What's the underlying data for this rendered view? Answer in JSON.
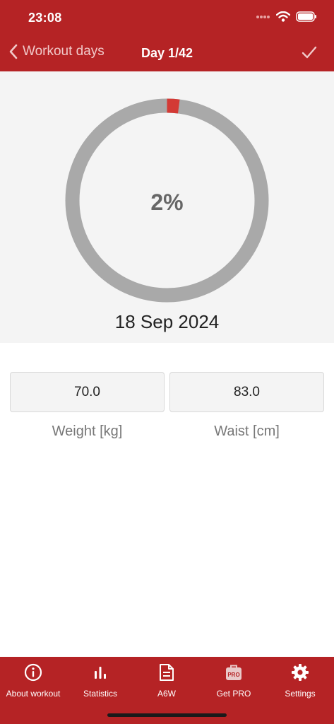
{
  "status_bar": {
    "time": "23:08"
  },
  "nav": {
    "back_label": "Workout days",
    "title": "Day 1/42"
  },
  "progress": {
    "percent": 2,
    "percent_label": "2%",
    "date": "18 Sep 2024",
    "colors": {
      "track": "#a9a9a9",
      "fill": "#d33a35"
    }
  },
  "measurements": {
    "weight": {
      "value": "70.0",
      "label": "Weight [kg]"
    },
    "waist": {
      "value": "83.0",
      "label": "Waist [cm]"
    }
  },
  "tabs": [
    {
      "label": "About workout",
      "icon": "info-icon"
    },
    {
      "label": "Statistics",
      "icon": "bar-chart-icon"
    },
    {
      "label": "A6W",
      "icon": "document-icon"
    },
    {
      "label": "Get PRO",
      "icon": "pro-bag-icon"
    },
    {
      "label": "Settings",
      "icon": "gear-icon"
    }
  ],
  "theme": {
    "brand": "#b52325"
  }
}
